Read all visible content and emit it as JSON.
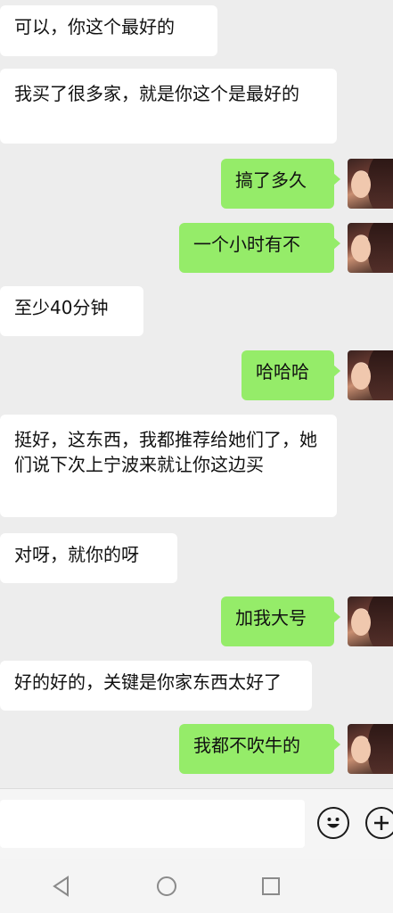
{
  "messages": [
    {
      "side": "in",
      "text": "可以，你这个最好的"
    },
    {
      "side": "in",
      "text": "我买了很多家，就是你这个是最好的"
    },
    {
      "side": "out",
      "text": "搞了多久"
    },
    {
      "side": "out",
      "text": "一个小时有不"
    },
    {
      "side": "in",
      "text": "至少40分钟"
    },
    {
      "side": "out",
      "text": "哈哈哈"
    },
    {
      "side": "in",
      "text": "挺好，这东西，我都推荐给她们了，她们说下次上宁波来就让你这边买"
    },
    {
      "side": "in",
      "text": "对呀，就你的呀"
    },
    {
      "side": "out",
      "text": "加我大号"
    },
    {
      "side": "in",
      "text": "好的好的，关键是你家东西太好了"
    },
    {
      "side": "out",
      "text": "我都不吹牛的"
    }
  ],
  "input_bar": {
    "emoji_icon": "smiley-face-icon",
    "plus_icon": "plus-circle-icon"
  },
  "nav_bar": {
    "back_icon": "triangle-back-icon",
    "home_icon": "circle-home-icon",
    "recents_icon": "square-recents-icon"
  },
  "colors": {
    "background": "#ededed",
    "incoming_bubble": "#ffffff",
    "outgoing_bubble": "#95ec69"
  }
}
